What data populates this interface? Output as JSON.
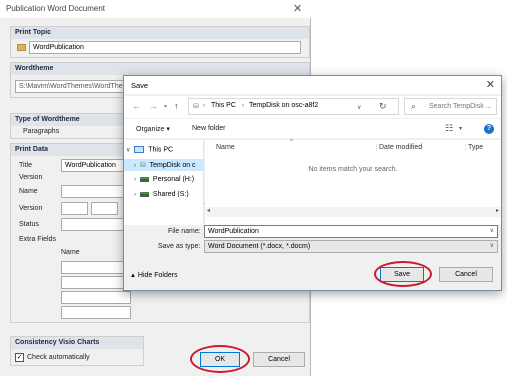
{
  "publication_dialog": {
    "title": "Publication Word Document",
    "print_topic": {
      "header": "Print Topic",
      "value": "WordPublication"
    },
    "wordtheme": {
      "header": "Wordtheme",
      "path": "S:\\Mavim\\WordThemes\\WordThe"
    },
    "type_of_wordtheme": {
      "header": "Type of Wordtheme",
      "value": "Paragraphs"
    },
    "print_data": {
      "header": "Print Data",
      "title_label": "Title",
      "title_value": "WordPublication",
      "version_label": "Version",
      "name_label": "Name",
      "version2_label": "Version",
      "status_label": "Status",
      "extra_fields_label": "Extra Fields",
      "name_col": "Name"
    },
    "consistency": {
      "header": "Consistency Visio Charts",
      "checkbox_label": "Check automatically",
      "checked": true
    },
    "ok_label": "OK",
    "cancel_label": "Cancel"
  },
  "save_dialog": {
    "title": "Save",
    "breadcrumb": [
      "This PC",
      "TempDisk on osc-a8f2"
    ],
    "search_placeholder": "Search TempDisk ...",
    "organize_label": "Organize ▾",
    "new_folder_label": "New folder",
    "tree": [
      {
        "label": "This PC",
        "icon": "pc-icon"
      },
      {
        "label": "TempDisk on c",
        "icon": "network-drive-icon",
        "selected": true
      },
      {
        "label": "Personal (H:)",
        "icon": "drive-icon"
      },
      {
        "label": "Shared (S:)",
        "icon": "drive-icon"
      }
    ],
    "columns": [
      "Name",
      "Date modified",
      "Type"
    ],
    "empty_message": "No items match your search.",
    "file_name_label": "File name:",
    "file_name_value": "WordPublication",
    "save_as_type_label": "Save as type:",
    "save_as_type_value": "Word Document (*.docx, *.docm)",
    "hide_folders_label": "Hide Folders",
    "save_label": "Save",
    "cancel_label": "Cancel"
  },
  "colors": {
    "annotation_ring": "#cc1b2a",
    "accent": "#0078d7",
    "section_header": "#dfe3ea"
  }
}
